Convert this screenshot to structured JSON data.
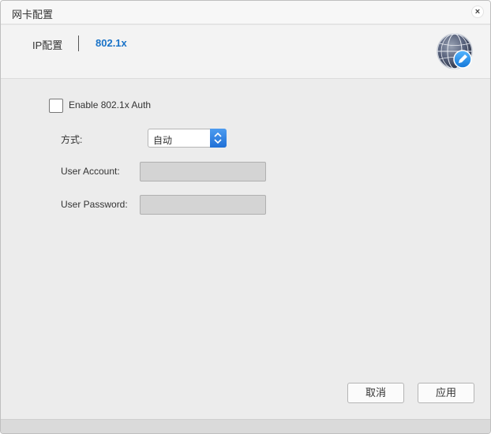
{
  "window": {
    "title": "网卡配置",
    "close_glyph": "×"
  },
  "tabs": [
    {
      "label": "IP配置",
      "active": false
    },
    {
      "label": "802.1x",
      "active": true
    }
  ],
  "header": {
    "icon": "globe-edit-icon",
    "accent_color": "#1a73c8"
  },
  "form": {
    "enable_label": "Enable 802.1x Auth",
    "enable_checked": false,
    "method_label": "方式:",
    "method_value": "自动",
    "account_label": "User Account:",
    "account_value": "",
    "password_label": "User Password:",
    "password_value": ""
  },
  "buttons": {
    "cancel": "取消",
    "apply": "应用"
  }
}
